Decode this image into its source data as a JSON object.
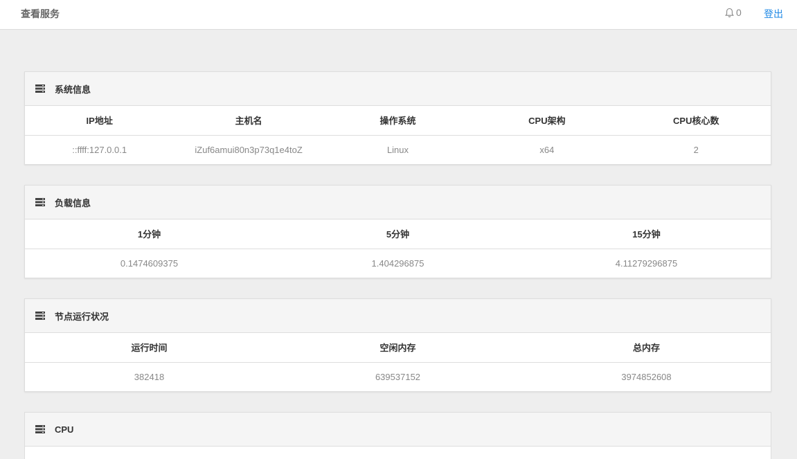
{
  "header": {
    "title": "查看服务",
    "notification_count": "0",
    "logout_label": "登出"
  },
  "system": {
    "title": "系统信息",
    "columns": [
      "IP地址",
      "主机名",
      "操作系统",
      "CPU架构",
      "CPU核心数"
    ],
    "values": [
      "::ffff:127.0.0.1",
      "iZuf6amui80n3p73q1e4toZ",
      "Linux",
      "x64",
      "2"
    ]
  },
  "load": {
    "title": "负载信息",
    "columns": [
      "1分钟",
      "5分钟",
      "15分钟"
    ],
    "values": [
      "0.1474609375",
      "1.404296875",
      "4.11279296875"
    ]
  },
  "node": {
    "title": "节点运行状况",
    "columns": [
      "运行时间",
      "空闲内存",
      "总内存"
    ],
    "values": [
      "382418",
      "639537152",
      "3974852608"
    ]
  },
  "cpu": {
    "title": "CPU"
  },
  "icons": {
    "panel": "server-stack-icon",
    "bell": "bell-icon"
  },
  "colors": {
    "accent": "#1e88e5",
    "background": "#eeeeee",
    "panel_header": "#f5f5f5"
  }
}
